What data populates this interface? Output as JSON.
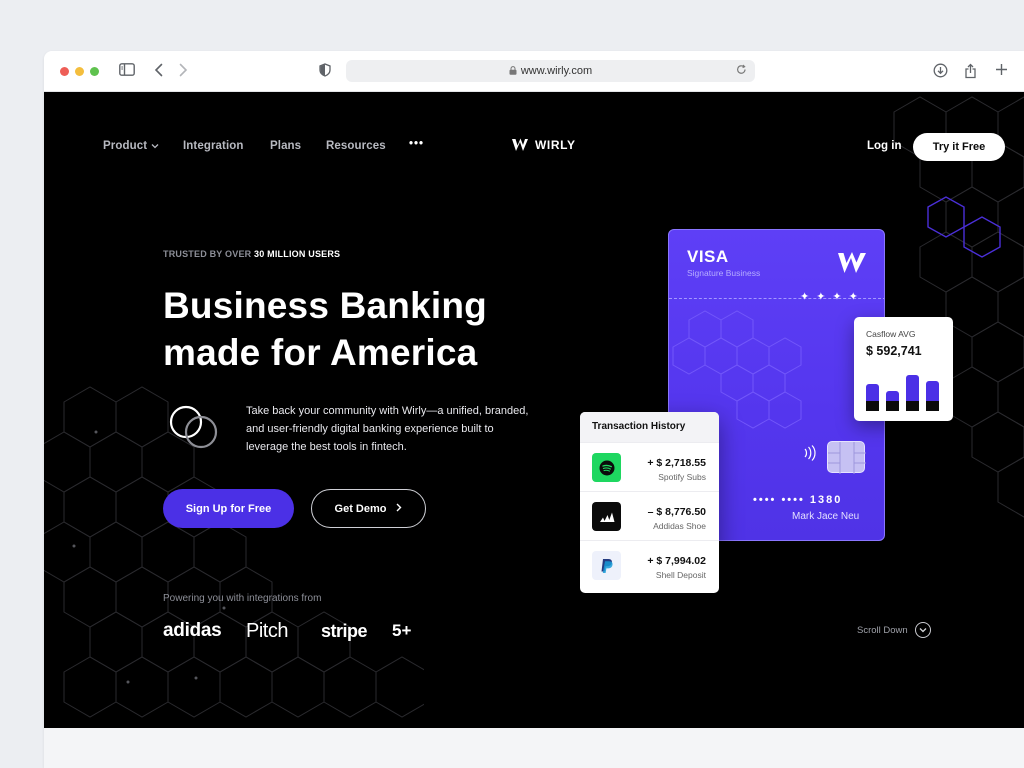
{
  "browser": {
    "url": "www.wirly.com"
  },
  "nav": {
    "items": [
      {
        "label": "Product"
      },
      {
        "label": "Integration"
      },
      {
        "label": "Plans"
      },
      {
        "label": "Resources"
      }
    ],
    "more_label": "•••",
    "brand": "WIRLY",
    "login": "Log in",
    "cta": "Try it Free"
  },
  "hero": {
    "trusted_prefix": "TRUSTED BY OVER ",
    "trusted_highlight": "30 MILLION USERS",
    "headline_line1": "Business Banking",
    "headline_line2": "made for America",
    "description": "Take back your community with Wirly—a unified, branded, and user-friendly digital banking experience built to leverage the best tools in fintech.",
    "primary_button": "Sign Up for Free",
    "secondary_button": "Get Demo"
  },
  "integrations": {
    "label": "Powering you with integrations from",
    "logos": [
      "adidas",
      "Pitch",
      "stripe",
      "5+"
    ]
  },
  "card": {
    "network": "VISA",
    "tier": "Signature Business",
    "stars": "✦✦✦✦",
    "number": "•••• •••• 1380",
    "holder": "Mark Jace Neu"
  },
  "cashflow": {
    "label": "Casflow AVG",
    "value": "$ 592,741",
    "bars": [
      0.68,
      0.5,
      0.9,
      0.74
    ]
  },
  "transactions": {
    "title": "Transaction History",
    "rows": [
      {
        "amount": "+ $ 2,718.55",
        "desc": "Spotify Subs",
        "icon": "spotify-icon"
      },
      {
        "amount": "– $ 8,776.50",
        "desc": "Addidas Shoe",
        "icon": "adidas-icon"
      },
      {
        "amount": "+ $ 7,994.02",
        "desc": "Shell Deposit",
        "icon": "paypal-icon"
      }
    ]
  },
  "scroll": {
    "label": "Scroll Down"
  },
  "colors": {
    "accent": "#4b30e6",
    "background": "#000000",
    "card": "#5a3cf4"
  }
}
